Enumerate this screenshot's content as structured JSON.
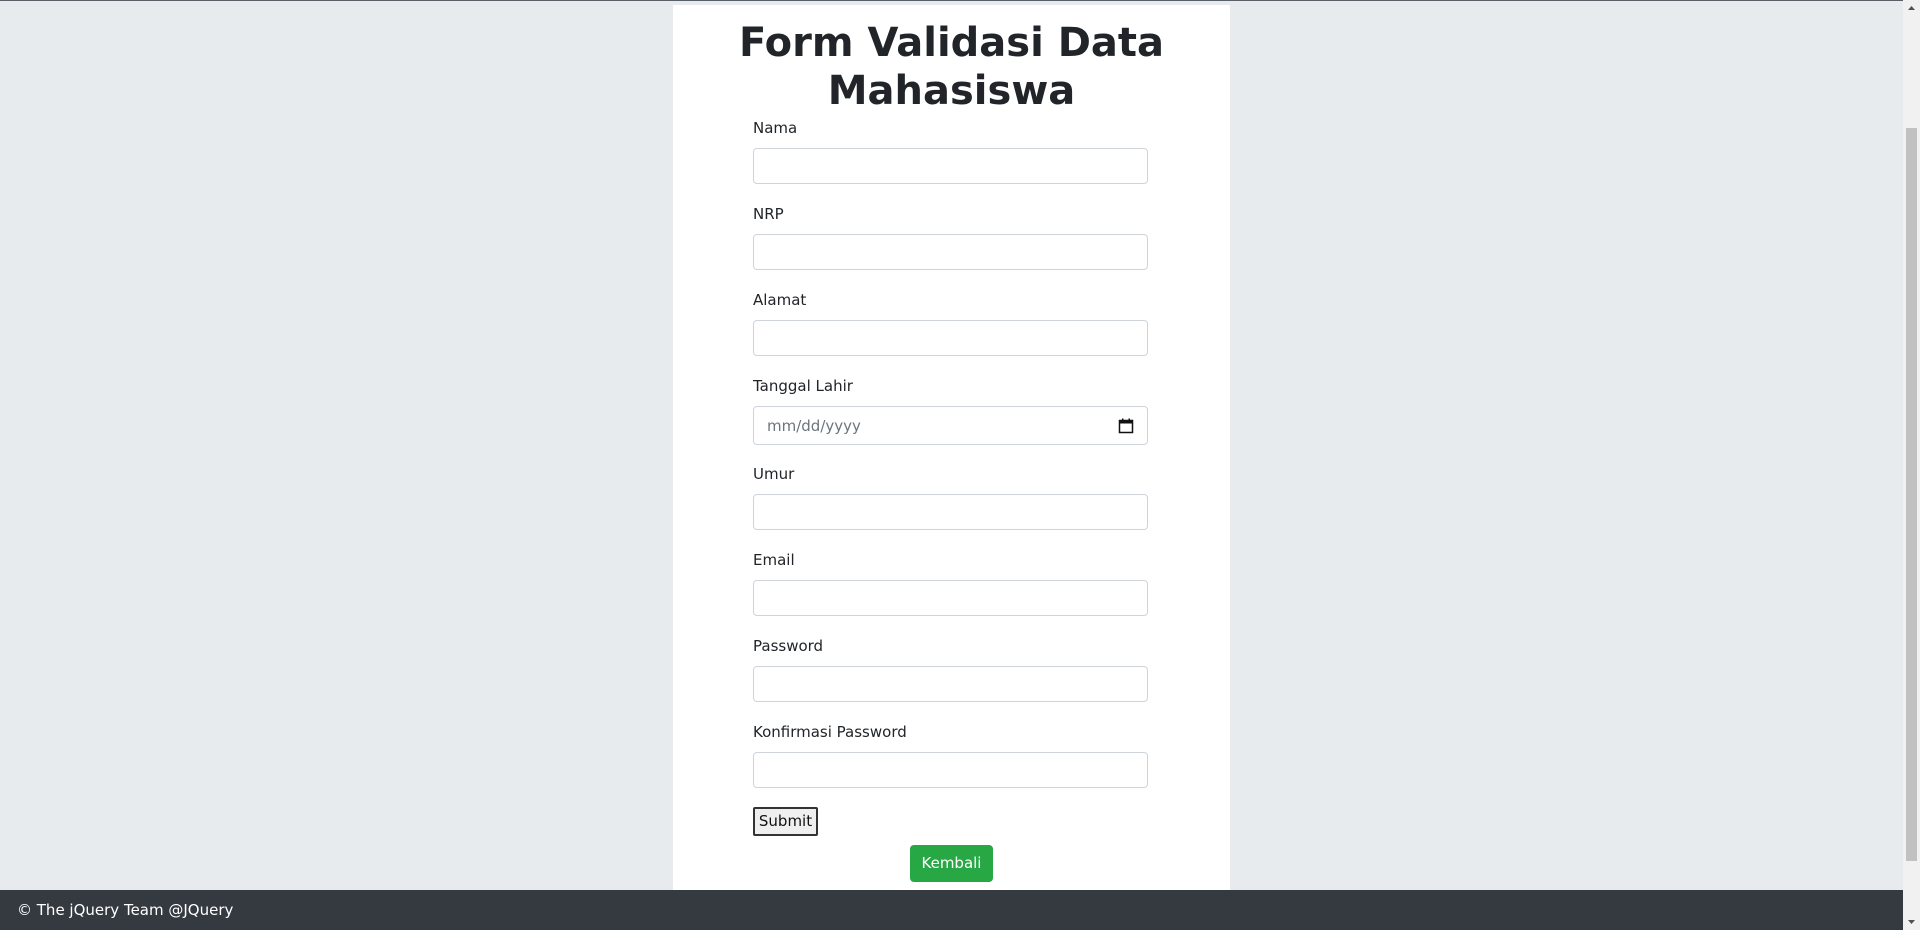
{
  "form": {
    "title": "Form Validasi Data Mahasiswa",
    "fields": [
      {
        "label": "Nama",
        "value": ""
      },
      {
        "label": "NRP",
        "value": ""
      },
      {
        "label": "Alamat",
        "value": ""
      },
      {
        "label": "Tanggal Lahir",
        "placeholder": "mm/dd/yyyy"
      },
      {
        "label": "Umur",
        "value": ""
      },
      {
        "label": "Email",
        "value": ""
      },
      {
        "label": "Password",
        "value": ""
      },
      {
        "label": "Konfirmasi Password",
        "value": ""
      }
    ],
    "submit_label": "Submit",
    "back_label": "Kembali"
  },
  "footer": {
    "text": "© The jQuery Team @JQuery"
  },
  "colors": {
    "background": "#e8ebee",
    "card": "#ffffff",
    "back_button": "#28a745",
    "footer": "#343a40"
  },
  "icons": {
    "calendar": "calendar-icon",
    "scroll_up": "scroll-up-arrow-icon",
    "scroll_down": "scroll-down-arrow-icon"
  }
}
